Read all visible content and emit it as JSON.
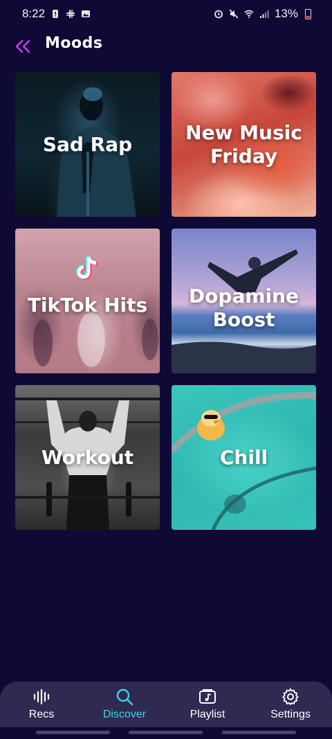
{
  "status_bar": {
    "time": "8:22",
    "battery": "13%"
  },
  "header": {
    "title": "Moods",
    "back_icon": "double-chevron-left-icon",
    "accent_color": "#c43cf0"
  },
  "moods": [
    {
      "label": "Sad Rap"
    },
    {
      "label": "New Music Friday"
    },
    {
      "label": "TikTok Hits"
    },
    {
      "label": "Dopamine Boost"
    },
    {
      "label": "Workout"
    },
    {
      "label": "Chill"
    }
  ],
  "bottom_nav": {
    "active_color": "#3fd3e6",
    "items": [
      {
        "label": "Recs",
        "icon": "waveform-icon"
      },
      {
        "label": "Discover",
        "icon": "search-icon",
        "active": true
      },
      {
        "label": "Playlist",
        "icon": "playlist-icon"
      },
      {
        "label": "Settings",
        "icon": "gear-icon"
      }
    ]
  }
}
